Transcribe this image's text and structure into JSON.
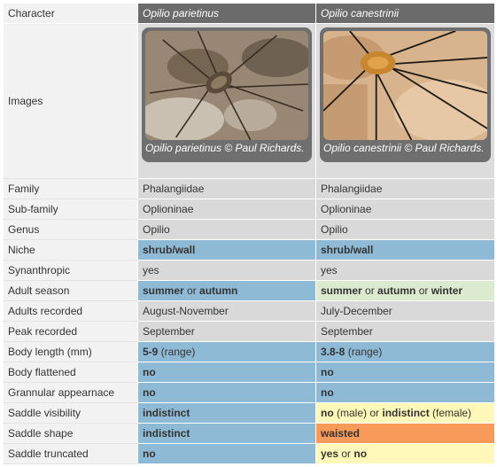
{
  "header": {
    "label": "Character",
    "species1": "Opilio parietinus",
    "species2": "Opilio canestrinii"
  },
  "images": {
    "label": "Images",
    "caption1": "Opilio parietinus © Paul Richards.",
    "caption2": "Opilio canestrinii © Paul Richards."
  },
  "rows": [
    {
      "label": "Family",
      "a": "Phalangiidae",
      "b": "Phalangiidae"
    },
    {
      "label": "Sub-family",
      "a": "Oplioninae",
      "b": "Oplioninae"
    },
    {
      "label": "Genus",
      "a": "Opilio",
      "b": "Opilio"
    },
    {
      "label": "Niche",
      "a": "shrub/wall",
      "b": "shrub/wall"
    },
    {
      "label": "Synanthropic",
      "a": "yes",
      "b": "yes"
    },
    {
      "label": "Adult season",
      "a_parts": [
        "summer",
        " or ",
        "autumn"
      ],
      "b_parts": [
        "summer",
        " or ",
        "autumn",
        " or ",
        "winter"
      ]
    },
    {
      "label": "Adults recorded",
      "a": "August-November",
      "b": "July-December"
    },
    {
      "label": "Peak recorded",
      "a": "September",
      "b": "September"
    },
    {
      "label": "Body length (mm)",
      "a_parts": [
        "5-9",
        " (range)"
      ],
      "b_parts": [
        "3.8-8",
        " (range)"
      ]
    },
    {
      "label": "Body flattened",
      "a": "no",
      "b": "no"
    },
    {
      "label": "Grannular appearnace",
      "a": "no",
      "b": "no"
    },
    {
      "label": "Saddle visibility",
      "a": "indistinct",
      "b_parts": [
        "no",
        " (male) or ",
        "indistinct",
        " (female)"
      ]
    },
    {
      "label": "Saddle shape",
      "a": "indistinct",
      "b": "waisted"
    },
    {
      "label": "Saddle truncated",
      "a": "no",
      "b_parts": [
        "yes",
        " or ",
        "no"
      ]
    }
  ]
}
